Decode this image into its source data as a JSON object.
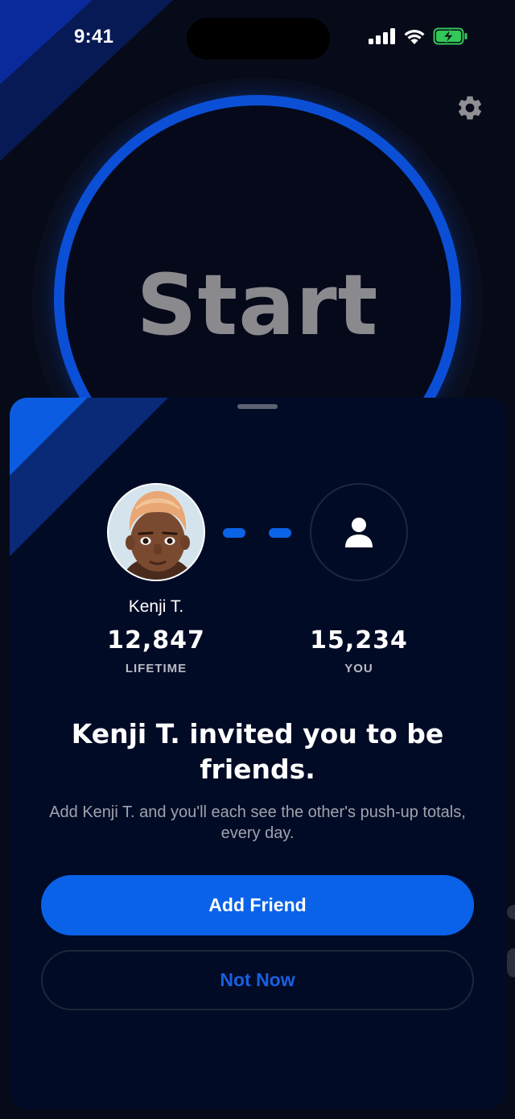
{
  "status_bar": {
    "time": "9:41",
    "icons": [
      "cellular-signal-icon",
      "wifi-icon",
      "battery-charging-icon"
    ]
  },
  "main": {
    "start_label": "Start",
    "settings_icon": "gear-icon"
  },
  "invite_sheet": {
    "friend": {
      "name": "Kenji T.",
      "count": "12,847",
      "caption": "LIFETIME"
    },
    "you": {
      "count": "15,234",
      "caption": "YOU",
      "icon": "person-icon"
    },
    "title": "Kenji T. invited you to be friends.",
    "description": "Add Kenji T. and you'll each see the other's push-up totals, every day.",
    "add_button_label": "Add Friend",
    "not_now_label": "Not Now"
  },
  "colors": {
    "accent": "#0a62e8",
    "ring": "#0b4fd6",
    "sheet_background": "#020b26",
    "screen_background": "#070b19",
    "not_now_text": "#1a5fe0",
    "battery": "#34c759"
  }
}
